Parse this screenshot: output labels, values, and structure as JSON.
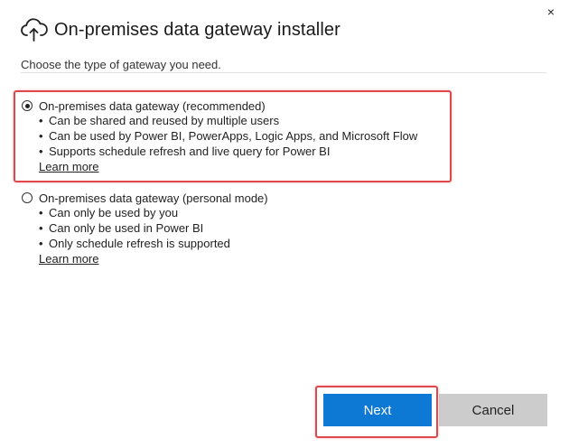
{
  "window": {
    "title": "On-premises data gateway installer",
    "close_label": "×"
  },
  "main": {
    "subtitle": "Choose the type of gateway you need.",
    "options": [
      {
        "label": "On-premises data gateway (recommended)",
        "selected": true,
        "bullets": [
          "Can be shared and reused by multiple users",
          "Can be used by Power BI, PowerApps, Logic Apps, and Microsoft Flow",
          "Supports schedule refresh and live query for Power BI"
        ],
        "learn_more": "Learn more"
      },
      {
        "label": "On-premises data gateway (personal mode)",
        "selected": false,
        "bullets": [
          "Can only be used by you",
          "Can only be used in Power BI",
          "Only schedule refresh is supported"
        ],
        "learn_more": "Learn more"
      }
    ]
  },
  "footer": {
    "next_label": "Next",
    "cancel_label": "Cancel"
  },
  "colors": {
    "accent": "#0e78d5",
    "highlight": "#e0474c",
    "cancel_bg": "#cccccc"
  },
  "icons": {
    "title": "cloud-upload-icon",
    "close": "close-icon"
  }
}
